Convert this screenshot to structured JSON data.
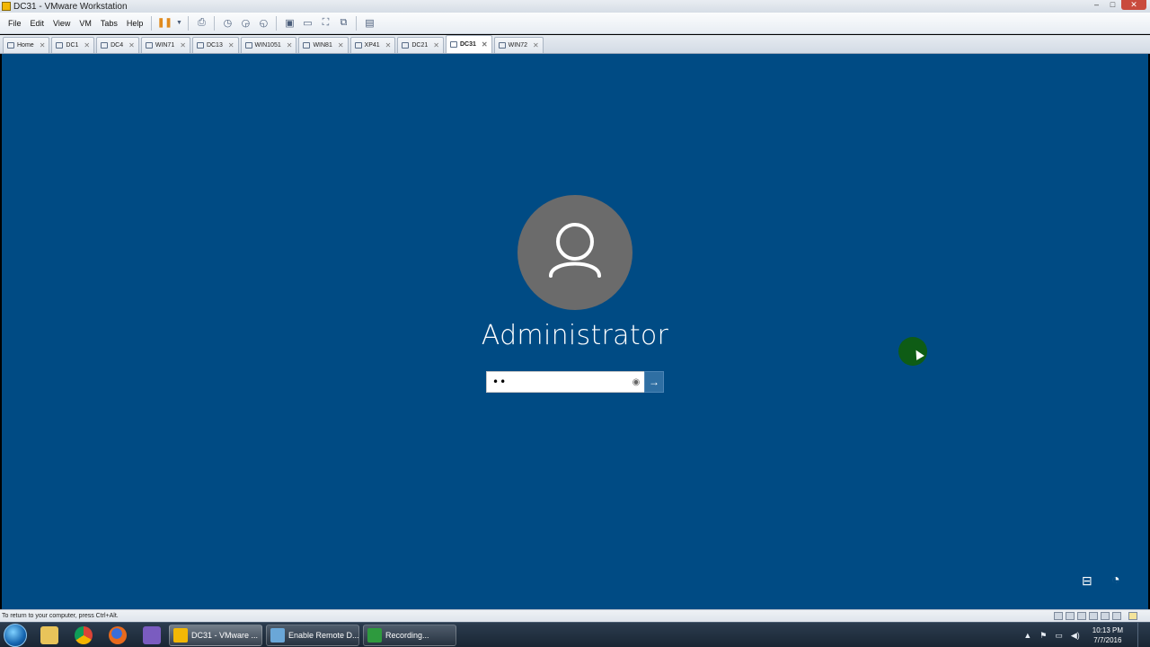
{
  "window": {
    "title": "DC31 - VMware Workstation",
    "controls": {
      "minimize": "–",
      "maximize": "□",
      "close": "✕"
    }
  },
  "menu": [
    "File",
    "Edit",
    "View",
    "VM",
    "Tabs",
    "Help"
  ],
  "tabs": [
    {
      "label": "Home",
      "active": false
    },
    {
      "label": "DC1",
      "active": false
    },
    {
      "label": "DC4",
      "active": false
    },
    {
      "label": "WIN71",
      "active": false
    },
    {
      "label": "DC13",
      "active": false
    },
    {
      "label": "WIN1051",
      "active": false
    },
    {
      "label": "WIN81",
      "active": false
    },
    {
      "label": "XP41",
      "active": false
    },
    {
      "label": "DC21",
      "active": false
    },
    {
      "label": "DC31",
      "active": true
    },
    {
      "label": "WIN72",
      "active": false
    }
  ],
  "login": {
    "username": "Administrator",
    "password_masked": "••",
    "reveal_icon": "eye-icon",
    "submit_icon": "arrow-right-icon"
  },
  "status_bar": {
    "hint": "To return to your computer, press Ctrl+Alt."
  },
  "taskbar": {
    "pinned": [
      {
        "name": "explorer",
        "color": "#e8c45a"
      },
      {
        "name": "chrome",
        "color": "#3a9c4a"
      },
      {
        "name": "firefox",
        "color": "#e86a1c"
      },
      {
        "name": "visual-studio",
        "color": "#7a5cc0"
      }
    ],
    "tasks": [
      {
        "label": "DC31 - VMware ...",
        "active": true,
        "color": "#f2b705"
      },
      {
        "label": "Enable Remote D...",
        "active": false,
        "color": "#6aa7d8"
      },
      {
        "label": "Recording...",
        "active": false,
        "color": "#2e9a3e"
      }
    ],
    "clock": {
      "time": "10:13 PM",
      "date": "7/7/2016"
    }
  },
  "colors": {
    "vm_background": "#004b84",
    "avatar": "#6b6b6b",
    "submit_button": "#2f6fa3",
    "cursor_highlight": "#0e5c15"
  }
}
